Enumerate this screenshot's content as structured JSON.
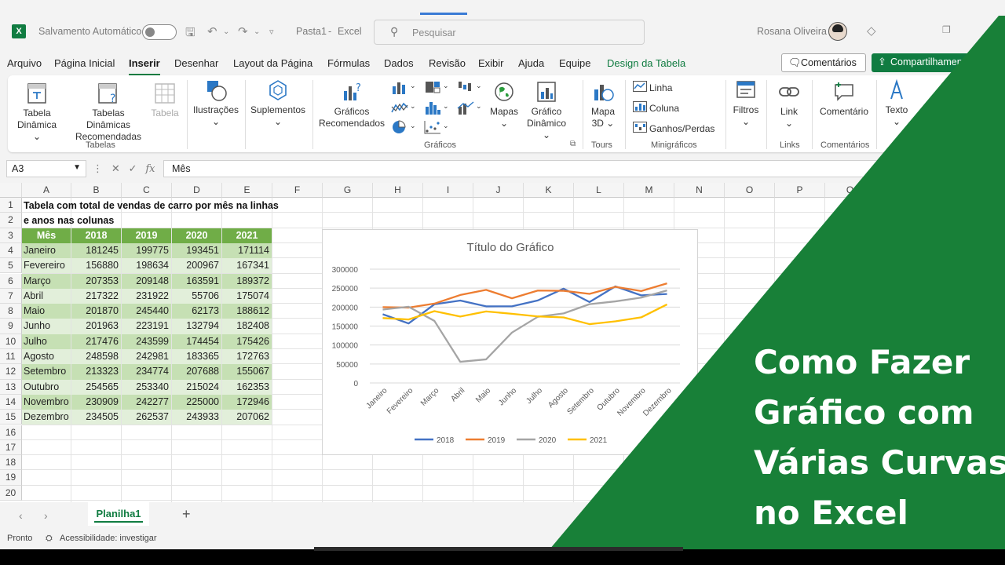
{
  "titlebar": {
    "autosave_label": "Salvamento Automático",
    "doc_title": "Pasta1",
    "app_name": "Excel",
    "search_placeholder": "Pesquisar",
    "user_name": "Rosana Oliveira"
  },
  "menu": {
    "tabs": [
      "Arquivo",
      "Página Inicial",
      "Inserir",
      "Desenhar",
      "Layout da Página",
      "Fórmulas",
      "Dados",
      "Revisão",
      "Exibir",
      "Ajuda",
      "Equipe",
      "Design da Tabela"
    ],
    "active_tab": "Inserir",
    "comments_button": "Comentários",
    "share_button": "Compartilhamento"
  },
  "ribbon": {
    "tabela_dinamica": "Tabela Dinâmica",
    "tabela_dinamica_line1": "Tabela",
    "tabela_dinamica_line2": "Dinâmica",
    "tabelas_recomendadas_line1": "Tabelas Dinâmicas",
    "tabelas_recomendadas_line2": "Recomendadas",
    "tabela": "Tabela",
    "group_tabelas": "Tabelas",
    "ilustracoes": "Ilustrações",
    "suplementos": "Suplementos",
    "graficos_recomendados_line1": "Gráficos",
    "graficos_recomendados_line2": "Recomendados",
    "mapas": "Mapas",
    "grafico_dinamico_line1": "Gráfico",
    "grafico_dinamico_line2": "Dinâmico",
    "group_graficos": "Gráficos",
    "mapa3d_line1": "Mapa",
    "mapa3d_line2": "3D",
    "group_tours": "Tours",
    "linha": "Linha",
    "coluna": "Coluna",
    "ganhos_perdas": "Ganhos/Perdas",
    "group_minigraficos": "Minigráficos",
    "filtros": "Filtros",
    "link": "Link",
    "group_links": "Links",
    "comentario": "Comentário",
    "group_comentarios": "Comentários",
    "texto": "Texto"
  },
  "formula": {
    "name_box": "A3",
    "content": "Mês"
  },
  "grid": {
    "columns": [
      "A",
      "B",
      "C",
      "D",
      "E",
      "F",
      "G",
      "H",
      "I",
      "J",
      "K",
      "L",
      "M",
      "N",
      "O",
      "P",
      "Q"
    ],
    "rows": [
      "1",
      "2",
      "3",
      "4",
      "5",
      "6",
      "7",
      "8",
      "9",
      "10",
      "11",
      "12",
      "13",
      "14",
      "15",
      "16",
      "17",
      "18",
      "19",
      "20"
    ],
    "title_line1": "Tabela com total de vendas de carro por mês na linhas",
    "title_line2": "e anos nas colunas",
    "table_headers": [
      "Mês",
      "2018",
      "2019",
      "2020",
      "2021"
    ],
    "table_rows": [
      [
        "Janeiro",
        "181245",
        "199775",
        "193451",
        "171114"
      ],
      [
        "Fevereiro",
        "156880",
        "198634",
        "200967",
        "167341"
      ],
      [
        "Março",
        "207353",
        "209148",
        "163591",
        "189372"
      ],
      [
        "Abril",
        "217322",
        "231922",
        "55706",
        "175074"
      ],
      [
        "Maio",
        "201870",
        "245440",
        "62173",
        "188612"
      ],
      [
        "Junho",
        "201963",
        "223191",
        "132794",
        "182408"
      ],
      [
        "Julho",
        "217476",
        "243599",
        "174454",
        "175426"
      ],
      [
        "Agosto",
        "248598",
        "242981",
        "183365",
        "172763"
      ],
      [
        "Setembro",
        "213323",
        "234774",
        "207688",
        "155067"
      ],
      [
        "Outubro",
        "254565",
        "253340",
        "215024",
        "162353"
      ],
      [
        "Novembro",
        "230909",
        "242277",
        "225000",
        "172946"
      ],
      [
        "Dezembro",
        "234505",
        "262537",
        "243933",
        "207062"
      ]
    ]
  },
  "chart_data": {
    "type": "line",
    "title": "Título do Gráfico",
    "categories": [
      "Janeiro",
      "Fevereiro",
      "Março",
      "Abril",
      "Maio",
      "Junho",
      "Julho",
      "Agosto",
      "Setembro",
      "Outubro",
      "Novembro",
      "Dezembro"
    ],
    "yticks": [
      0,
      50000,
      100000,
      150000,
      200000,
      250000,
      300000
    ],
    "ylim": [
      0,
      300000
    ],
    "legend_position": "bottom",
    "series": [
      {
        "name": "2018",
        "color": "#4472c4",
        "values": [
          181245,
          156880,
          207353,
          217322,
          201870,
          201963,
          217476,
          248598,
          213323,
          254565,
          230909,
          234505
        ]
      },
      {
        "name": "2019",
        "color": "#ed7d31",
        "values": [
          199775,
          198634,
          209148,
          231922,
          245440,
          223191,
          243599,
          242981,
          234774,
          253340,
          242277,
          262537
        ]
      },
      {
        "name": "2020",
        "color": "#a5a5a5",
        "values": [
          193451,
          200967,
          163591,
          55706,
          62173,
          132794,
          174454,
          183365,
          207688,
          215024,
          225000,
          243933
        ]
      },
      {
        "name": "2021",
        "color": "#ffc000",
        "values": [
          171114,
          167341,
          189372,
          175074,
          188612,
          182408,
          175426,
          172763,
          155067,
          162353,
          172946,
          207062
        ]
      }
    ]
  },
  "sheets": {
    "active": "Planilha1"
  },
  "status": {
    "ready": "Pronto",
    "accessibility": "Acessibilidade: investigar"
  },
  "promo": {
    "line1": "Como Fazer",
    "line2": "Gráfico com",
    "line3": "Várias Curvas",
    "line4": "no Excel"
  },
  "colors": {
    "excel_green": "#107c41",
    "table_header": "#70ad47",
    "band_dark": "#c6e0b4",
    "band_light": "#e2efda",
    "banner_green": "#188038"
  }
}
